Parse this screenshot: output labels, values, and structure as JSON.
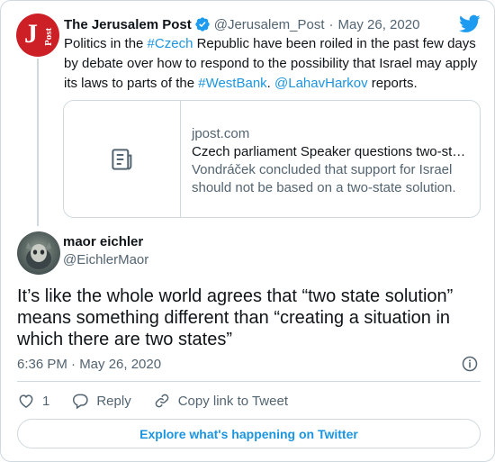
{
  "parent_tweet": {
    "author_name": "The Jerusalem Post",
    "handle": "@Jerusalem_Post",
    "separator": "·",
    "date": "May 26, 2020",
    "avatar_letters": {
      "big": "J",
      "small": "Post"
    },
    "text_parts": [
      {
        "text": "Politics in the ",
        "link": false
      },
      {
        "text": "#Czech",
        "link": true
      },
      {
        "text": " Republic have been roiled in the past few days by debate over how to respond to the possibility that Israel may apply its laws to parts of the ",
        "link": false
      },
      {
        "text": "#WestBank",
        "link": true
      },
      {
        "text": ". ",
        "link": false
      },
      {
        "text": "@LahavHarkov",
        "link": true
      },
      {
        "text": " reports.",
        "link": false
      }
    ],
    "link_preview": {
      "domain": "jpost.com",
      "title": "Czech parliament Speaker questions two-st…",
      "description": "Vondráček concluded that support for Israel should not be based on a two-state solution."
    }
  },
  "main_tweet": {
    "author_name": "maor eichler",
    "handle": "@EichlerMaor",
    "text": "It’s like the whole world agrees that “two state solution” means something different than “creating a situation in which there are two states”",
    "timestamp": "6:36 PM · May 26, 2020"
  },
  "actions": {
    "like_count": "1",
    "reply_label": "Reply",
    "copy_link_label": "Copy link to Tweet"
  },
  "explore_label": "Explore what's happening on Twitter",
  "colors": {
    "link": "#1b95e0",
    "brand_red": "#cc1f26",
    "muted": "#536471",
    "border": "#cfd9de"
  },
  "icons": [
    "verified-badge-icon",
    "twitter-bird-icon",
    "document-icon",
    "info-icon",
    "heart-icon",
    "reply-bubble-icon",
    "link-icon"
  ]
}
